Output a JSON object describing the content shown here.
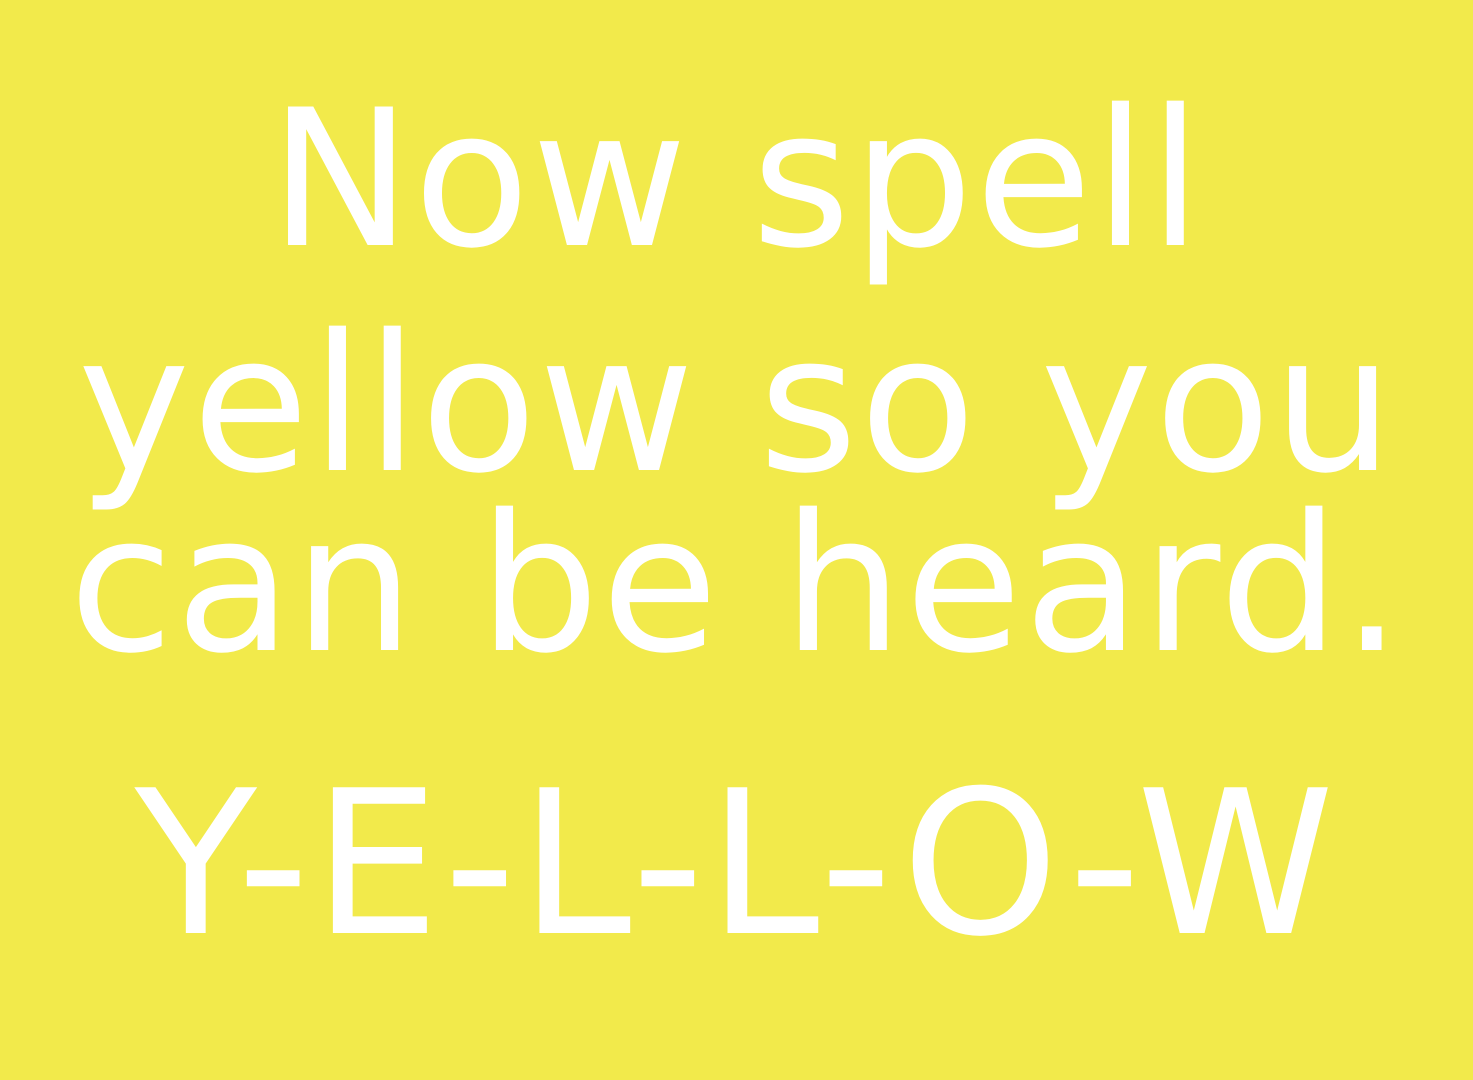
{
  "background_color": "#f2ea4b",
  "text_color": "#ffffff",
  "lines": [
    "Now spell",
    "yellow so you",
    "can be heard.",
    "Y-E-L-L-O-W"
  ]
}
